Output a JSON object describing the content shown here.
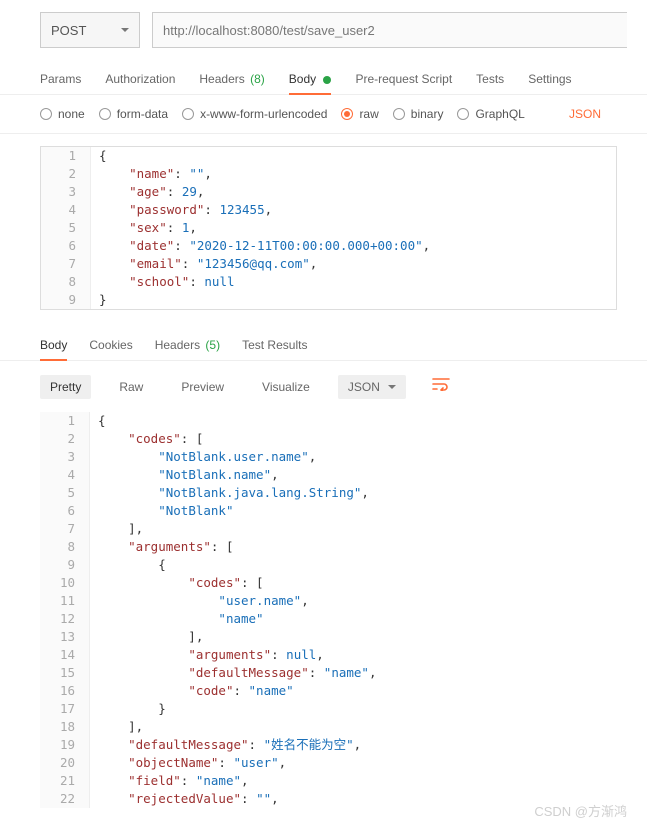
{
  "request": {
    "method": "POST",
    "url": "http://localhost:8080/test/save_user2"
  },
  "reqTabs": {
    "params": "Params",
    "auth": "Authorization",
    "headers": "Headers",
    "headersCount": "(8)",
    "body": "Body",
    "prereq": "Pre-request Script",
    "tests": "Tests",
    "settings": "Settings"
  },
  "bodyTypes": {
    "none": "none",
    "formdata": "form-data",
    "xform": "x-www-form-urlencoded",
    "raw": "raw",
    "binary": "binary",
    "graphql": "GraphQL",
    "json": "JSON"
  },
  "reqLines": [
    {
      "n": "1",
      "tokens": [
        {
          "t": "{",
          "c": "punc"
        }
      ]
    },
    {
      "n": "2",
      "tokens": [
        {
          "t": "    ",
          "c": "punc"
        },
        {
          "t": "\"name\"",
          "c": "key"
        },
        {
          "t": ": ",
          "c": "punc"
        },
        {
          "t": "\"\"",
          "c": "str"
        },
        {
          "t": ",",
          "c": "punc"
        }
      ]
    },
    {
      "n": "3",
      "tokens": [
        {
          "t": "    ",
          "c": "punc"
        },
        {
          "t": "\"age\"",
          "c": "key"
        },
        {
          "t": ": ",
          "c": "punc"
        },
        {
          "t": "29",
          "c": "num"
        },
        {
          "t": ",",
          "c": "punc"
        }
      ]
    },
    {
      "n": "4",
      "tokens": [
        {
          "t": "    ",
          "c": "punc"
        },
        {
          "t": "\"password\"",
          "c": "key"
        },
        {
          "t": ": ",
          "c": "punc"
        },
        {
          "t": "123455",
          "c": "num"
        },
        {
          "t": ",",
          "c": "punc"
        }
      ]
    },
    {
      "n": "5",
      "tokens": [
        {
          "t": "    ",
          "c": "punc"
        },
        {
          "t": "\"sex\"",
          "c": "key"
        },
        {
          "t": ": ",
          "c": "punc"
        },
        {
          "t": "1",
          "c": "num"
        },
        {
          "t": ",",
          "c": "punc"
        }
      ]
    },
    {
      "n": "6",
      "tokens": [
        {
          "t": "    ",
          "c": "punc"
        },
        {
          "t": "\"date\"",
          "c": "key"
        },
        {
          "t": ": ",
          "c": "punc"
        },
        {
          "t": "\"2020-12-11T00:00:00.000+00:00\"",
          "c": "str"
        },
        {
          "t": ",",
          "c": "punc"
        }
      ]
    },
    {
      "n": "7",
      "tokens": [
        {
          "t": "    ",
          "c": "punc"
        },
        {
          "t": "\"email\"",
          "c": "key"
        },
        {
          "t": ": ",
          "c": "punc"
        },
        {
          "t": "\"123456@qq.com\"",
          "c": "str"
        },
        {
          "t": ",",
          "c": "punc"
        }
      ]
    },
    {
      "n": "8",
      "tokens": [
        {
          "t": "    ",
          "c": "punc"
        },
        {
          "t": "\"school\"",
          "c": "key"
        },
        {
          "t": ": ",
          "c": "punc"
        },
        {
          "t": "null",
          "c": "kw"
        }
      ]
    },
    {
      "n": "9",
      "tokens": [
        {
          "t": "}",
          "c": "punc"
        }
      ]
    }
  ],
  "respTabs": {
    "body": "Body",
    "cookies": "Cookies",
    "headers": "Headers",
    "headersCount": "(5)",
    "test": "Test Results"
  },
  "viewBar": {
    "pretty": "Pretty",
    "raw": "Raw",
    "preview": "Preview",
    "visualize": "Visualize",
    "json": "JSON"
  },
  "respLines": [
    {
      "n": "1",
      "tokens": [
        {
          "t": "{",
          "c": "punc"
        }
      ]
    },
    {
      "n": "2",
      "tokens": [
        {
          "t": "    ",
          "c": "punc"
        },
        {
          "t": "\"codes\"",
          "c": "key"
        },
        {
          "t": ": [",
          "c": "punc"
        }
      ]
    },
    {
      "n": "3",
      "tokens": [
        {
          "t": "        ",
          "c": "punc"
        },
        {
          "t": "\"NotBlank.user.name\"",
          "c": "str"
        },
        {
          "t": ",",
          "c": "punc"
        }
      ]
    },
    {
      "n": "4",
      "tokens": [
        {
          "t": "        ",
          "c": "punc"
        },
        {
          "t": "\"NotBlank.name\"",
          "c": "str"
        },
        {
          "t": ",",
          "c": "punc"
        }
      ]
    },
    {
      "n": "5",
      "tokens": [
        {
          "t": "        ",
          "c": "punc"
        },
        {
          "t": "\"NotBlank.java.lang.String\"",
          "c": "str"
        },
        {
          "t": ",",
          "c": "punc"
        }
      ]
    },
    {
      "n": "6",
      "tokens": [
        {
          "t": "        ",
          "c": "punc"
        },
        {
          "t": "\"NotBlank\"",
          "c": "str"
        }
      ]
    },
    {
      "n": "7",
      "tokens": [
        {
          "t": "    ],",
          "c": "punc"
        }
      ]
    },
    {
      "n": "8",
      "tokens": [
        {
          "t": "    ",
          "c": "punc"
        },
        {
          "t": "\"arguments\"",
          "c": "key"
        },
        {
          "t": ": [",
          "c": "punc"
        }
      ]
    },
    {
      "n": "9",
      "tokens": [
        {
          "t": "        {",
          "c": "punc"
        }
      ]
    },
    {
      "n": "10",
      "tokens": [
        {
          "t": "            ",
          "c": "punc"
        },
        {
          "t": "\"codes\"",
          "c": "key"
        },
        {
          "t": ": [",
          "c": "punc"
        }
      ]
    },
    {
      "n": "11",
      "tokens": [
        {
          "t": "                ",
          "c": "punc"
        },
        {
          "t": "\"user.name\"",
          "c": "str"
        },
        {
          "t": ",",
          "c": "punc"
        }
      ]
    },
    {
      "n": "12",
      "tokens": [
        {
          "t": "                ",
          "c": "punc"
        },
        {
          "t": "\"name\"",
          "c": "str"
        }
      ]
    },
    {
      "n": "13",
      "tokens": [
        {
          "t": "            ],",
          "c": "punc"
        }
      ]
    },
    {
      "n": "14",
      "tokens": [
        {
          "t": "            ",
          "c": "punc"
        },
        {
          "t": "\"arguments\"",
          "c": "key"
        },
        {
          "t": ": ",
          "c": "punc"
        },
        {
          "t": "null",
          "c": "kw"
        },
        {
          "t": ",",
          "c": "punc"
        }
      ]
    },
    {
      "n": "15",
      "tokens": [
        {
          "t": "            ",
          "c": "punc"
        },
        {
          "t": "\"defaultMessage\"",
          "c": "key"
        },
        {
          "t": ": ",
          "c": "punc"
        },
        {
          "t": "\"name\"",
          "c": "str"
        },
        {
          "t": ",",
          "c": "punc"
        }
      ]
    },
    {
      "n": "16",
      "tokens": [
        {
          "t": "            ",
          "c": "punc"
        },
        {
          "t": "\"code\"",
          "c": "key"
        },
        {
          "t": ": ",
          "c": "punc"
        },
        {
          "t": "\"name\"",
          "c": "str"
        }
      ]
    },
    {
      "n": "17",
      "tokens": [
        {
          "t": "        }",
          "c": "punc"
        }
      ]
    },
    {
      "n": "18",
      "tokens": [
        {
          "t": "    ],",
          "c": "punc"
        }
      ]
    },
    {
      "n": "19",
      "tokens": [
        {
          "t": "    ",
          "c": "punc"
        },
        {
          "t": "\"defaultMessage\"",
          "c": "key"
        },
        {
          "t": ": ",
          "c": "punc"
        },
        {
          "t": "\"姓名不能为空\"",
          "c": "str"
        },
        {
          "t": ",",
          "c": "punc"
        }
      ]
    },
    {
      "n": "20",
      "tokens": [
        {
          "t": "    ",
          "c": "punc"
        },
        {
          "t": "\"objectName\"",
          "c": "key"
        },
        {
          "t": ": ",
          "c": "punc"
        },
        {
          "t": "\"user\"",
          "c": "str"
        },
        {
          "t": ",",
          "c": "punc"
        }
      ]
    },
    {
      "n": "21",
      "tokens": [
        {
          "t": "    ",
          "c": "punc"
        },
        {
          "t": "\"field\"",
          "c": "key"
        },
        {
          "t": ": ",
          "c": "punc"
        },
        {
          "t": "\"name\"",
          "c": "str"
        },
        {
          "t": ",",
          "c": "punc"
        }
      ]
    },
    {
      "n": "22",
      "tokens": [
        {
          "t": "    ",
          "c": "punc"
        },
        {
          "t": "\"rejectedValue\"",
          "c": "key"
        },
        {
          "t": ": ",
          "c": "punc"
        },
        {
          "t": "\"\"",
          "c": "str"
        },
        {
          "t": ",",
          "c": "punc"
        }
      ]
    }
  ],
  "watermark": "CSDN @方渐鸿"
}
